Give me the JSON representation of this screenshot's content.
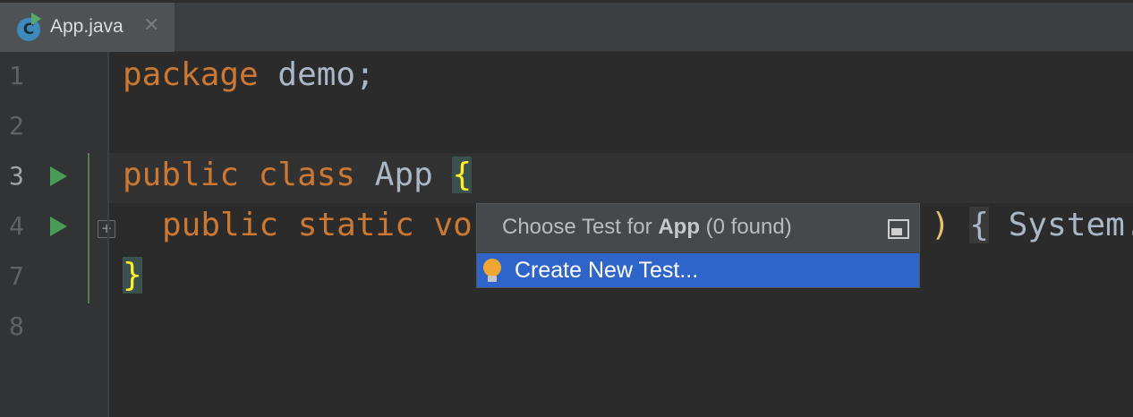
{
  "tab": {
    "icon_letter": "C",
    "label": "App.java",
    "close_glyph": "✕"
  },
  "gutter": {
    "line_numbers": [
      "1",
      "2",
      "3",
      "4",
      "7",
      "8"
    ],
    "fold_glyph": "+"
  },
  "code": {
    "line1": {
      "kw": "package",
      "rest": " demo;"
    },
    "line3": {
      "kw1": "public",
      "kw2": "class",
      "name": " App ",
      "brace": "{"
    },
    "line4": {
      "kw1": "public",
      "kw2": "static",
      "kw3": "vo",
      "paren": ")",
      "brace": "{",
      "rest": "System."
    },
    "line7": {
      "brace": "}"
    }
  },
  "popup": {
    "title_prefix": "Choose Test for",
    "title_bold": "App",
    "title_suffix": "(0 found)",
    "item_label": "Create New Test...",
    "pin_icon": "pin-icon",
    "item_icon": "bulb-icon"
  },
  "colors": {
    "keyword": "#cc7832",
    "text": "#a9b7c6",
    "selection": "#2f65ca",
    "run_marker": "#499c54"
  }
}
